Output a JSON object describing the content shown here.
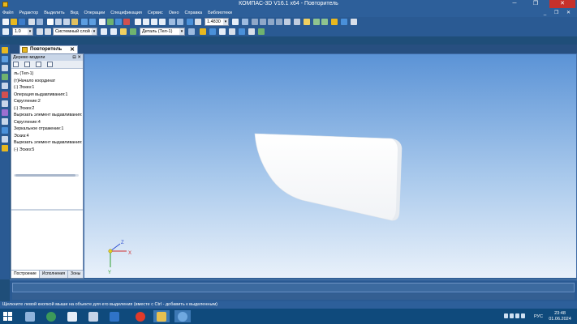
{
  "window": {
    "title": "КОМПАС-3D V16.1 x64 - Повторитель",
    "minimize_glyph": "─",
    "maximize_glyph": "❐",
    "close_glyph": "✕"
  },
  "menu": {
    "items": [
      "Файл",
      "Редактор",
      "Выделить",
      "Вид",
      "Операции",
      "Спецификация",
      "Сервис",
      "Окно",
      "Справка",
      "Библиотеки"
    ],
    "doc_controls": "_ ❐ ✕"
  },
  "toolbar": {
    "scale_value": "1.0",
    "layer_value": "Системный слой (0)",
    "zoom_value": "1.4830",
    "part_value": "Деталь (Тел-1)"
  },
  "document_tab": {
    "label": "Повторитель",
    "close_glyph": "✕"
  },
  "model_tree": {
    "title": "Дерево модели",
    "header_buttons": "⊟ ✕",
    "nodes": [
      "ль (Тел-1)",
      "(т)Начало координат",
      "(-) Эскиз:1",
      "Операция выдавливания:1",
      "Скругление:2",
      "(-) Эскиз:2",
      "Вырезать элемент выдавливания:",
      "Скругление:4",
      "Зеркальное отражение:1",
      "Эскиз:4",
      "Вырезать элемент выдавливания:",
      "(-) Эскиз:5"
    ],
    "bottom_tabs": [
      "Построение",
      "Исполнения",
      "Зоны"
    ]
  },
  "triad": {
    "x_label": "X",
    "y_label": "Y",
    "z_label": "Z"
  },
  "status": {
    "text": "Щелкните левой кнопкой мыши на объекте для его выделения (вместе с Ctrl - добавить к выделенным)"
  },
  "taskbar": {
    "language": "РУС",
    "time": "23:48",
    "date": "01.06.2024"
  },
  "colors": {
    "chrome_blue": "#2d5f9a",
    "viewport_top": "#5b93d6",
    "viewport_bottom": "#e9f1fa",
    "close_red": "#c7312b"
  }
}
